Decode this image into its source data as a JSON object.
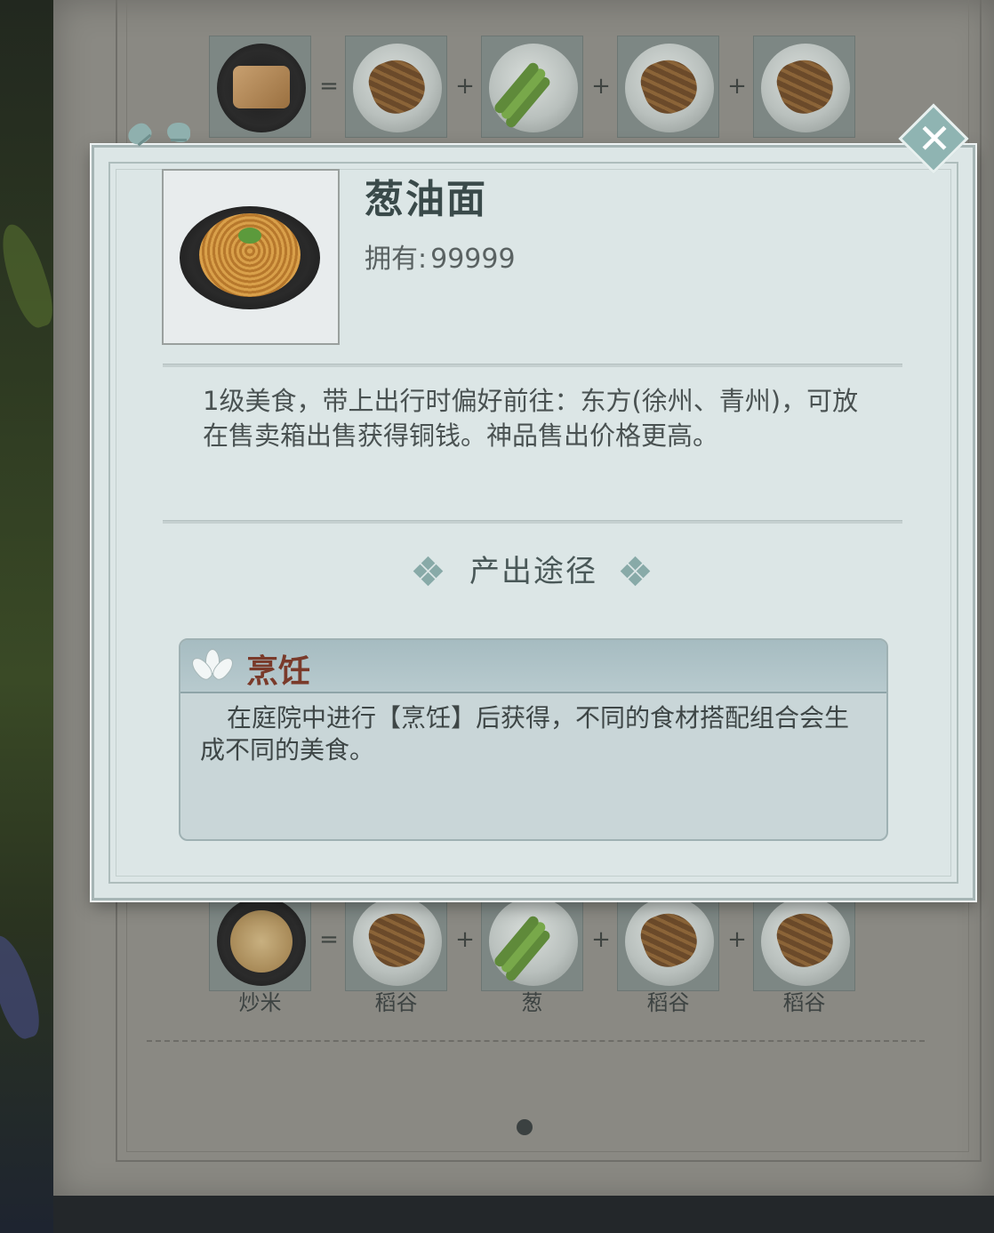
{
  "item": {
    "name": "葱油面",
    "owned_label": "拥有:",
    "owned_value": "99999",
    "description": "1级美食，带上出行时偏好前往：东方(徐州、青州)，可放在售卖箱出售获得铜钱。神品售出价格更高。"
  },
  "section": {
    "title": "产出途径"
  },
  "source": {
    "title": "烹饪",
    "text": "在庭院中进行【烹饪】后获得，不同的食材搭配组合会生成不同的美食。"
  },
  "recipe_bottom": {
    "result": "炒米",
    "ingredients": [
      "稻谷",
      "葱",
      "稻谷",
      "稻谷"
    ],
    "equals": "=",
    "plus": "+"
  },
  "recipe_top": {
    "equals": "=",
    "plus": "+"
  },
  "icons": {
    "close": "close-x-icon",
    "lotus": "lotus-icon",
    "ornament": "diamond-ornament-icon"
  }
}
